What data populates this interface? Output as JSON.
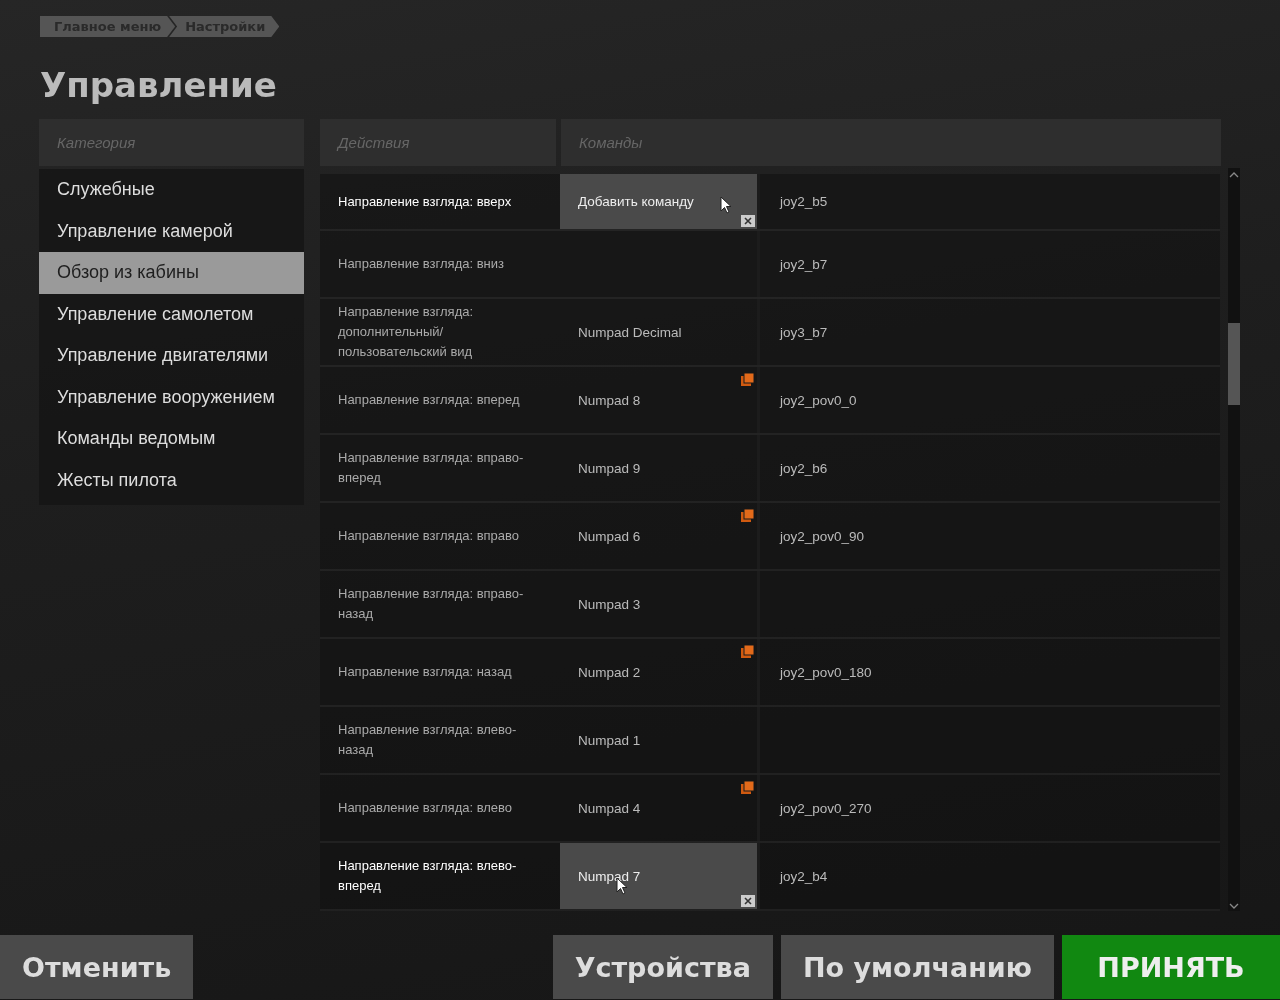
{
  "breadcrumb": [
    {
      "label": "Главное меню"
    },
    {
      "label": "Настройки"
    }
  ],
  "title": "Управление",
  "categories": {
    "header": "Категория",
    "items": [
      {
        "label": "Служебные",
        "selected": false
      },
      {
        "label": "Управление камерой",
        "selected": false
      },
      {
        "label": "Обзор из кабины",
        "selected": true
      },
      {
        "label": "Управление самолетом",
        "selected": false
      },
      {
        "label": "Управление двигателями",
        "selected": false
      },
      {
        "label": "Управление вооружением",
        "selected": false
      },
      {
        "label": "Команды ведомым",
        "selected": false
      },
      {
        "label": "Жесты пилота",
        "selected": false
      }
    ]
  },
  "table": {
    "columns": [
      "Действия",
      "Команды"
    ],
    "rows": [
      {
        "action": "Направление взгляда: вверх",
        "command_1": "Добавить команду",
        "command_2": "joy2_b5",
        "highlighted": true,
        "conflict": false
      },
      {
        "action": "Направление взгляда: вниз",
        "command_2": "joy2_b7",
        "highlighted": false,
        "conflict": false
      },
      {
        "action": "Направление взгляда: дополнительный/пользовательский вид",
        "command_1": "Numpad Decimal",
        "command_2": "joy3_b7",
        "highlighted": false,
        "conflict": false
      },
      {
        "action": "Направление взгляда: вперед",
        "command_1": "Numpad 8",
        "command_2": "joy2_pov0_0",
        "highlighted": false,
        "conflict": true
      },
      {
        "action": "Направление взгляда: вправо-вперед",
        "command_1": "Numpad 9",
        "command_2": "joy2_b6",
        "highlighted": false,
        "conflict": false
      },
      {
        "action": "Направление взгляда: вправо",
        "command_1": "Numpad 6",
        "command_2": "joy2_pov0_90",
        "highlighted": false,
        "conflict": true
      },
      {
        "action": "Направление взгляда: вправо-назад",
        "command_1": "Numpad 3",
        "highlighted": false,
        "conflict": false
      },
      {
        "action": "Направление взгляда: назад",
        "command_1": "Numpad 2",
        "command_2": "joy2_pov0_180",
        "highlighted": false,
        "conflict": true
      },
      {
        "action": "Направление взгляда: влево-назад",
        "command_1": "Numpad 1",
        "highlighted": false,
        "conflict": false
      },
      {
        "action": "Направление взгляда: влево",
        "command_1": "Numpad 4",
        "command_2": "joy2_pov0_270",
        "highlighted": false,
        "conflict": true
      },
      {
        "action": "Направление взгляда: влево-вперед",
        "command_1": "Numpad 7",
        "command_2": "joy2_b4",
        "highlighted": true,
        "conflict": false
      }
    ]
  },
  "buttons": [
    {
      "label": "Отменить",
      "kind": "cancel"
    },
    {
      "label": "Устройства",
      "kind": "secondary"
    },
    {
      "label": "По умолчанию",
      "kind": "secondary"
    },
    {
      "label": "ПРИНЯТЬ",
      "kind": "primary"
    }
  ]
}
